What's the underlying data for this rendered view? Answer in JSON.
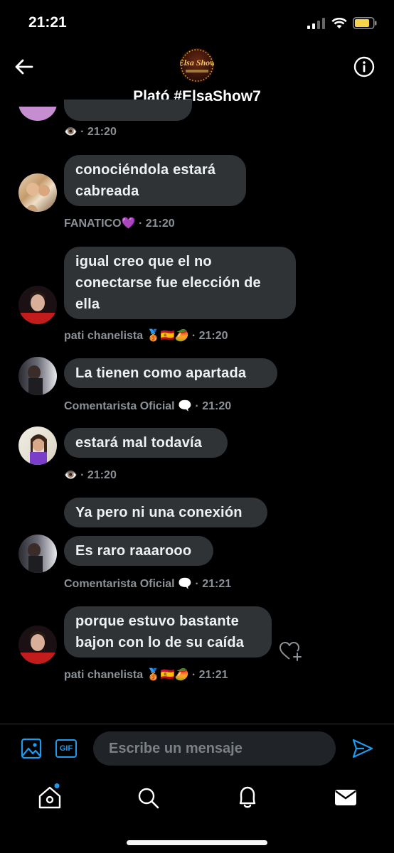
{
  "status": {
    "time": "21:21"
  },
  "header": {
    "title": "Plató #ElsaShow7",
    "avatar_text": "Elsa Show"
  },
  "messages": [
    {
      "text": "",
      "meta_name": "👁️",
      "time": "· 21:20"
    },
    {
      "text": "conociéndola estará cabreada",
      "meta_name": "FANATICO💜",
      "time": "· 21:20"
    },
    {
      "text": "igual creo que el no conectarse fue elección de ella",
      "meta_name": "pati chanelista 🥉🇪🇸🥭",
      "time": "· 21:20"
    },
    {
      "text": "La tienen como apartada",
      "meta_name": "Comentarista Oficial 🗨️",
      "time": "· 21:20"
    },
    {
      "text": "estará mal todavía",
      "meta_name": "👁️",
      "time": "· 21:20"
    },
    {
      "text": "Ya pero ni una conexión",
      "text2": "Es raro raaarooo",
      "meta_name": "Comentarista Oficial 🗨️",
      "time": "· 21:21"
    },
    {
      "text": "porque estuvo bastante bajon con lo de su caída",
      "meta_name": "pati chanelista 🥉🇪🇸🥭",
      "time": "· 21:21"
    }
  ],
  "composer": {
    "placeholder": "Escribe un mensaje",
    "gif_label": "GIF"
  },
  "colors": {
    "background": "#000000",
    "bubble": "#2f3336",
    "accent": "#1d9bf0",
    "meta": "#8b9196"
  }
}
